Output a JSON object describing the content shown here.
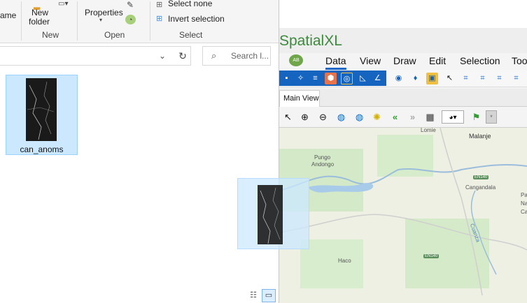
{
  "explorer": {
    "ribbon": {
      "partial_label": "ame",
      "new_folder_line1": "New",
      "new_folder_line2": "folder",
      "properties_label": "Properties",
      "select_none": "Select none",
      "invert_selection": "Invert selection",
      "groups": {
        "new": "New",
        "open": "Open",
        "select": "Select"
      }
    },
    "search": {
      "placeholder": "Search l..."
    },
    "files": [
      {
        "name": "can_anoms"
      }
    ]
  },
  "app": {
    "title": "SpatialXL",
    "avatar_text": "AB",
    "menu": [
      "Data",
      "View",
      "Draw",
      "Edit",
      "Selection",
      "Too"
    ],
    "tab": "Main View",
    "map": {
      "labels": [
        "Lomie",
        "Malanje",
        "Pungo",
        "Andongo",
        "Cangandala",
        "Par",
        "Nac",
        "Car",
        "Haco",
        "Cuanza"
      ],
      "road_shields": [
        "EN140",
        "EN140"
      ]
    }
  },
  "colors": {
    "accent_blue": "#1565c0",
    "title_green": "#3c8a3c",
    "selection": "#cce8ff"
  }
}
